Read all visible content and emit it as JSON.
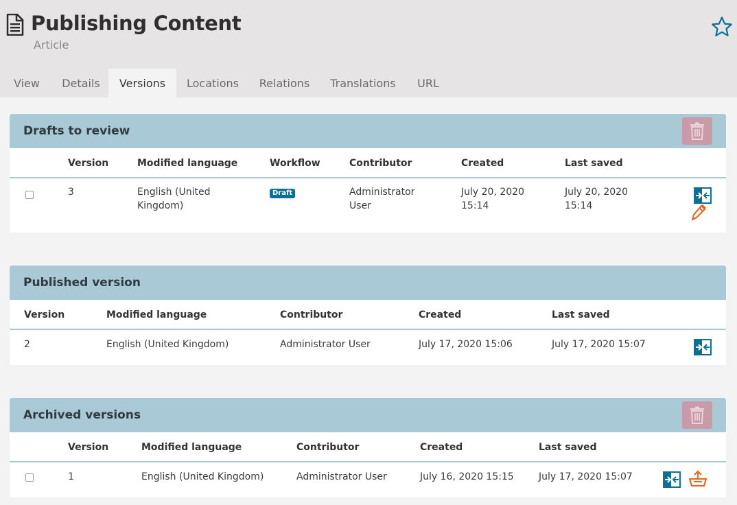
{
  "header": {
    "title": "Publishing Content",
    "subtitle": "Article",
    "doc_icon": "document-icon",
    "star_icon": "star-icon"
  },
  "tabs": [
    {
      "label": "View"
    },
    {
      "label": "Details"
    },
    {
      "label": "Versions",
      "active": true
    },
    {
      "label": "Locations"
    },
    {
      "label": "Relations"
    },
    {
      "label": "Translations"
    },
    {
      "label": "URL"
    }
  ],
  "drafts": {
    "title": "Drafts to review",
    "columns": [
      "Version",
      "Modified language",
      "Workflow",
      "Contributor",
      "Created",
      "Last saved"
    ],
    "rows": [
      {
        "version": "3",
        "language_line1": "English (United",
        "language_line2": "Kingdom)",
        "workflow": "Draft",
        "contributor_line1": "Administrator",
        "contributor_line2": "User",
        "created_line1": "July 20, 2020",
        "created_line2": "15:14",
        "saved_line1": "July 20, 2020",
        "saved_line2": "15:14"
      }
    ]
  },
  "published": {
    "title": "Published version",
    "columns": [
      "Version",
      "Modified language",
      "Contributor",
      "Created",
      "Last saved"
    ],
    "rows": [
      {
        "version": "2",
        "language": "English (United Kingdom)",
        "contributor": "Administrator User",
        "created": "July 17, 2020 15:06",
        "saved": "July 17, 2020 15:07"
      }
    ]
  },
  "archived": {
    "title": "Archived versions",
    "columns": [
      "Version",
      "Modified language",
      "Contributor",
      "Created",
      "Last saved"
    ],
    "rows": [
      {
        "version": "1",
        "language": "English (United Kingdom)",
        "contributor": "Administrator User",
        "created": "July 16, 2020 15:15",
        "saved": "July 17, 2020 15:07"
      }
    ]
  },
  "colors": {
    "panel_header": "#a8c9d5",
    "accent_blue": "#0c6f93",
    "accent_orange": "#e06b26",
    "trash_disabled": "#c99aa7"
  }
}
